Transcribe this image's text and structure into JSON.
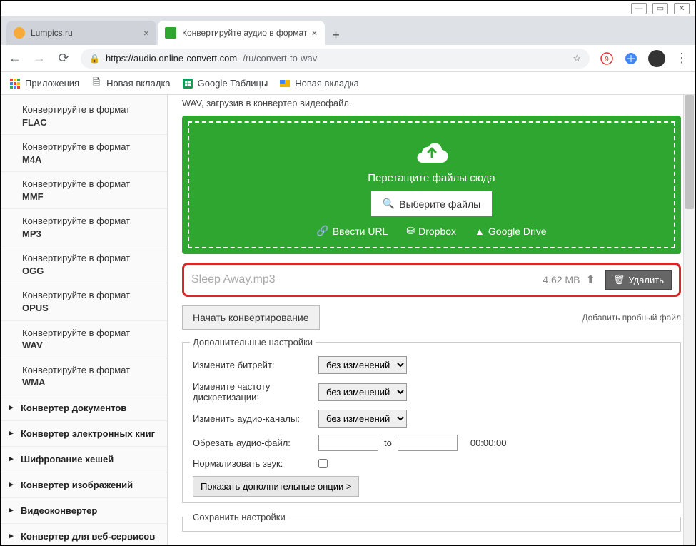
{
  "tabs": [
    {
      "title": "Lumpics.ru",
      "favicon": "#f7a93b"
    },
    {
      "title": "Конвертируйте аудио в формат",
      "favicon": "#2fa62f"
    }
  ],
  "url": {
    "domain": "https://audio.online-convert.com",
    "path": "/ru/convert-to-wav"
  },
  "bookmarks": [
    "Приложения",
    "Новая вкладка",
    "Google Таблицы",
    "Новая вкладка"
  ],
  "sidebar": {
    "convert_prefix": "Конвертируйте в формат",
    "formats": [
      "FLAC",
      "M4A",
      "MMF",
      "MP3",
      "OGG",
      "OPUS",
      "WAV",
      "WMA"
    ],
    "categories": [
      "Конвертер документов",
      "Конвертер электронных книг",
      "Шифрование хешей",
      "Конвертер изображений",
      "Видеоконвертер",
      "Конвертер для веб-сервисов"
    ]
  },
  "intro": "WAV, загрузив в конвертер видеофайл.",
  "dropzone": {
    "drag_text": "Перетащите файлы сюда",
    "select_btn": "Выберите файлы",
    "links": [
      "Ввести URL",
      "Dropbox",
      "Google Drive"
    ]
  },
  "file": {
    "name": "Sleep Away.mp3",
    "size": "4.62 MB",
    "delete_label": "Удалить"
  },
  "actions": {
    "start": "Начать конвертирование",
    "trial": "Добавить пробный файл"
  },
  "settings": {
    "legend": "Дополнительные настройки",
    "bitrate_label": "Измените битрейт:",
    "samplerate_label": "Измените частоту дискретизации:",
    "channels_label": "Изменить аудио-каналы:",
    "trim_label": "Обрезать аудио-файл:",
    "trim_to": "to",
    "trim_time": "00:00:00",
    "normalize_label": "Нормализовать звук:",
    "no_change": "без изменений",
    "more": "Показать дополнительные опции >"
  },
  "save_legend": "Сохранить настройки"
}
